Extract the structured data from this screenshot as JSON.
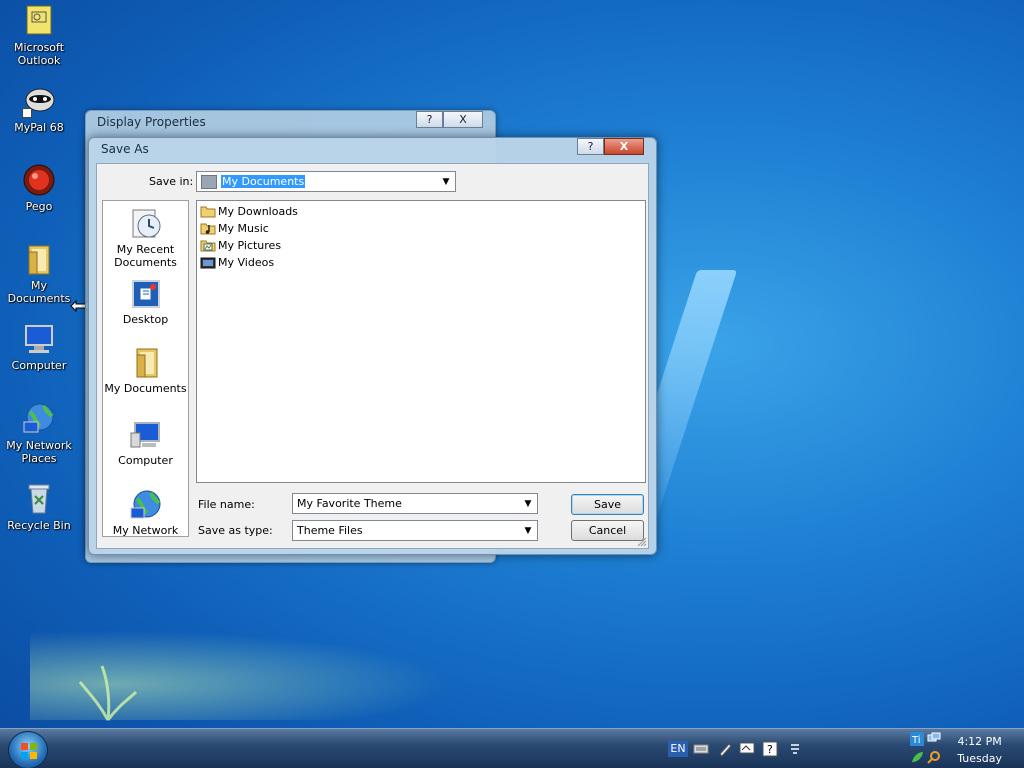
{
  "desktop": {
    "icons": [
      {
        "label": "Microsoft Outlook"
      },
      {
        "label": "MyPal 68"
      },
      {
        "label": "Pego"
      },
      {
        "label": "My Documents"
      },
      {
        "label": "Computer"
      },
      {
        "label": "My Network Places"
      },
      {
        "label": "Recycle Bin"
      }
    ]
  },
  "back_window": {
    "title": "Display Properties",
    "help": "?",
    "close": "X"
  },
  "save_dialog": {
    "title": "Save As",
    "help": "?",
    "close": "X",
    "save_in_label": "Save in:",
    "save_in_value": "My Documents",
    "places": [
      {
        "label": "My Recent Documents"
      },
      {
        "label": "Desktop"
      },
      {
        "label": "My Documents"
      },
      {
        "label": "Computer"
      },
      {
        "label": "My Network"
      }
    ],
    "files": [
      {
        "name": "My Downloads"
      },
      {
        "name": "My Music"
      },
      {
        "name": "My Pictures"
      },
      {
        "name": "My Videos"
      }
    ],
    "file_name_label": "File name:",
    "file_name_value": "My Favorite Theme",
    "save_type_label": "Save as type:",
    "save_type_value": "Theme Files",
    "save_button": "Save",
    "cancel_button": "Cancel"
  },
  "taskbar": {
    "lang": "EN",
    "time": "4:12 PM",
    "day": "Tuesday"
  },
  "colors": {
    "selection": "#3399ff",
    "close_button": "#c8452c",
    "desktop": "#1e7fd3"
  }
}
